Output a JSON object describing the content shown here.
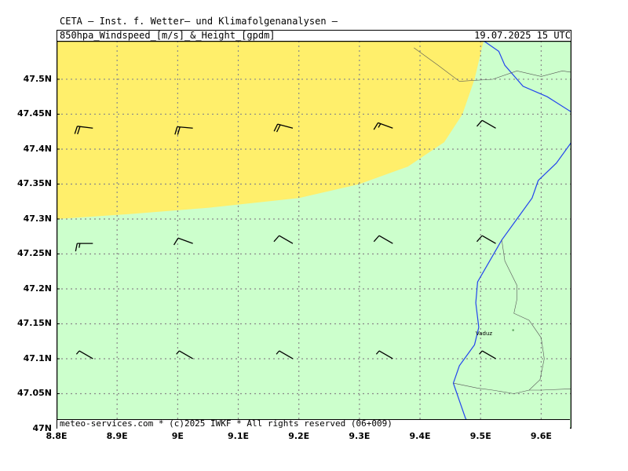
{
  "header": {
    "title": "CETA – Inst. f. Wetter– und Klimafolgenanalysen –",
    "subtitle": "850hpa_Windspeed_[m/s]_&_Height_[gpdm]",
    "valid_time": "19.07.2025 15 UTC"
  },
  "footer": {
    "credit": "meteo-services.com * (c)2025 IWKF * All rights reserved (06+009)"
  },
  "places": [
    {
      "name": "Vaduz",
      "lon": 9.52,
      "lat": 47.141
    }
  ],
  "colors": {
    "band_yellow": "#ffef6b",
    "band_green": "#ccffcc",
    "river": "#2244ee",
    "border": "#555555",
    "grid": "#888888",
    "barb": "#000000"
  },
  "chart_data": {
    "type": "map",
    "xlabel": "",
    "ylabel": "",
    "xlim": [
      8.8,
      9.65
    ],
    "ylim": [
      47.0,
      47.555
    ],
    "x_ticks": [
      {
        "value": 8.8,
        "label": "8.8E"
      },
      {
        "value": 8.9,
        "label": "8.9E"
      },
      {
        "value": 9.0,
        "label": "9E"
      },
      {
        "value": 9.1,
        "label": "9.1E"
      },
      {
        "value": 9.2,
        "label": "9.2E"
      },
      {
        "value": 9.3,
        "label": "9.3E"
      },
      {
        "value": 9.4,
        "label": "9.4E"
      },
      {
        "value": 9.5,
        "label": "9.5E"
      },
      {
        "value": 9.6,
        "label": "9.6E"
      }
    ],
    "y_ticks": [
      {
        "value": 47.0,
        "label": "47N"
      },
      {
        "value": 47.05,
        "label": "47.05N"
      },
      {
        "value": 47.1,
        "label": "47.1N"
      },
      {
        "value": 47.15,
        "label": "47.15N"
      },
      {
        "value": 47.2,
        "label": "47.2N"
      },
      {
        "value": 47.25,
        "label": "47.25N"
      },
      {
        "value": 47.3,
        "label": "47.3N"
      },
      {
        "value": 47.35,
        "label": "47.35N"
      },
      {
        "value": 47.4,
        "label": "47.4N"
      },
      {
        "value": 47.45,
        "label": "47.45N"
      },
      {
        "value": 47.5,
        "label": "47.5N"
      }
    ],
    "grid": true,
    "regions": [
      {
        "name": "",
        "color": "#ffef6b",
        "boundary": [
          [
            8.8,
            47.555
          ],
          [
            9.505,
            47.555
          ],
          [
            9.49,
            47.5
          ],
          [
            9.47,
            47.45
          ],
          [
            9.44,
            47.41
          ],
          [
            9.38,
            47.375
          ],
          [
            9.3,
            47.35
          ],
          [
            9.2,
            47.33
          ],
          [
            9.05,
            47.316
          ],
          [
            8.92,
            47.307
          ],
          [
            8.8,
            47.3
          ]
        ]
      }
    ],
    "wind_barbs": [
      {
        "lon": 8.86,
        "lat": 47.43,
        "dir_deg": 277,
        "speed_kt": 20
      },
      {
        "lon": 9.025,
        "lat": 47.43,
        "dir_deg": 275,
        "speed_kt": 20
      },
      {
        "lon": 9.19,
        "lat": 47.43,
        "dir_deg": 285,
        "speed_kt": 20
      },
      {
        "lon": 9.355,
        "lat": 47.43,
        "dir_deg": 290,
        "speed_kt": 15
      },
      {
        "lon": 9.525,
        "lat": 47.43,
        "dir_deg": 300,
        "speed_kt": 10
      },
      {
        "lon": 8.86,
        "lat": 47.265,
        "dir_deg": 270,
        "speed_kt": 15
      },
      {
        "lon": 9.025,
        "lat": 47.265,
        "dir_deg": 290,
        "speed_kt": 10
      },
      {
        "lon": 9.19,
        "lat": 47.265,
        "dir_deg": 300,
        "speed_kt": 10
      },
      {
        "lon": 9.355,
        "lat": 47.265,
        "dir_deg": 300,
        "speed_kt": 10
      },
      {
        "lon": 9.525,
        "lat": 47.265,
        "dir_deg": 300,
        "speed_kt": 10
      },
      {
        "lon": 8.86,
        "lat": 47.1,
        "dir_deg": 300,
        "speed_kt": 5
      },
      {
        "lon": 9.025,
        "lat": 47.1,
        "dir_deg": 300,
        "speed_kt": 5
      },
      {
        "lon": 9.19,
        "lat": 47.1,
        "dir_deg": 300,
        "speed_kt": 5
      },
      {
        "lon": 9.355,
        "lat": 47.1,
        "dir_deg": 300,
        "speed_kt": 5
      },
      {
        "lon": 9.525,
        "lat": 47.1,
        "dir_deg": 300,
        "speed_kt": 5
      }
    ],
    "lines": [
      {
        "kind": "river",
        "color": "#2244ee",
        "points": [
          [
            9.505,
            47.555
          ],
          [
            9.53,
            47.54
          ],
          [
            9.54,
            47.52
          ],
          [
            9.57,
            47.49
          ],
          [
            9.61,
            47.475
          ],
          [
            9.65,
            47.453
          ]
        ]
      },
      {
        "kind": "river",
        "color": "#2244ee",
        "points": [
          [
            9.65,
            47.41
          ],
          [
            9.625,
            47.38
          ],
          [
            9.595,
            47.355
          ],
          [
            9.585,
            47.33
          ],
          [
            9.56,
            47.3
          ],
          [
            9.535,
            47.27
          ],
          [
            9.515,
            47.24
          ],
          [
            9.495,
            47.21
          ],
          [
            9.492,
            47.18
          ],
          [
            9.497,
            47.145
          ],
          [
            9.49,
            47.12
          ],
          [
            9.465,
            47.09
          ],
          [
            9.455,
            47.065
          ],
          [
            9.465,
            47.04
          ],
          [
            9.475,
            47.015
          ],
          [
            9.485,
            47.0
          ]
        ]
      },
      {
        "kind": "border",
        "color": "#555555",
        "points": [
          [
            9.39,
            47.545
          ],
          [
            9.43,
            47.52
          ],
          [
            9.465,
            47.497
          ],
          [
            9.52,
            47.5
          ],
          [
            9.56,
            47.512
          ],
          [
            9.6,
            47.504
          ],
          [
            9.635,
            47.512
          ],
          [
            9.65,
            47.51
          ]
        ]
      },
      {
        "kind": "border",
        "color": "#555555",
        "points": [
          [
            9.535,
            47.27
          ],
          [
            9.54,
            47.24
          ],
          [
            9.56,
            47.205
          ],
          [
            9.56,
            47.185
          ],
          [
            9.555,
            47.165
          ],
          [
            9.58,
            47.155
          ],
          [
            9.6,
            47.13
          ],
          [
            9.605,
            47.1
          ],
          [
            9.598,
            47.07
          ],
          [
            9.58,
            47.055
          ],
          [
            9.555,
            47.05
          ],
          [
            9.52,
            47.055
          ],
          [
            9.495,
            47.058
          ],
          [
            9.455,
            47.065
          ]
        ]
      },
      {
        "kind": "border",
        "color": "#555555",
        "points": [
          [
            9.58,
            47.055
          ],
          [
            9.6,
            47.055
          ],
          [
            9.65,
            47.057
          ]
        ]
      }
    ]
  }
}
